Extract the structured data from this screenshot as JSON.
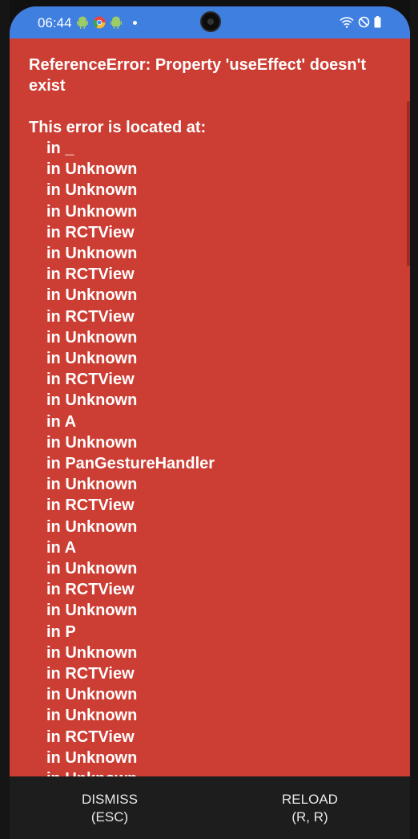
{
  "status_bar": {
    "time": "06:44",
    "left_icons": [
      "android-icon",
      "chrome-icon",
      "android-icon"
    ],
    "right_icons": [
      "wifi-icon",
      "do-not-disturb-icon",
      "battery-icon"
    ],
    "color": "#3f7fe0"
  },
  "error": {
    "title": "ReferenceError: Property 'useEffect' doesn't exist",
    "located_label": "This error is located at:",
    "stack": [
      "in _",
      "in Unknown",
      "in Unknown",
      "in Unknown",
      "in RCTView",
      "in Unknown",
      "in RCTView",
      "in Unknown",
      "in RCTView",
      "in Unknown",
      "in Unknown",
      "in RCTView",
      "in Unknown",
      "in A",
      "in Unknown",
      "in PanGestureHandler",
      "in Unknown",
      "in RCTView",
      "in Unknown",
      "in A",
      "in Unknown",
      "in RCTView",
      "in Unknown",
      "in P",
      "in Unknown",
      "in RCTView",
      "in Unknown",
      "in Unknown",
      "in RCTView",
      "in Unknown",
      "in Unknown"
    ],
    "background_color": "#cc3d33"
  },
  "footer": {
    "dismiss_label": "DISMISS",
    "dismiss_shortcut": "(ESC)",
    "reload_label": "RELOAD",
    "reload_shortcut": "(R, R)"
  }
}
